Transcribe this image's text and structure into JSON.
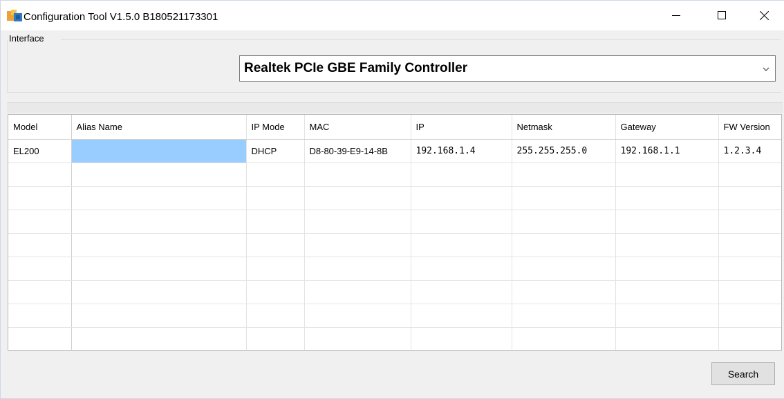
{
  "window": {
    "title": "Configuration Tool V1.5.0 B180521173301",
    "controls": {
      "minimize": "minimize-icon",
      "maximize": "maximize-icon",
      "close": "close-icon"
    }
  },
  "interface": {
    "group_label": "Interface",
    "selected_adapter": "Realtek PCIe GBE Family Controller"
  },
  "table": {
    "columns": [
      "Model",
      "Alias Name",
      "IP Mode",
      "MAC",
      "IP",
      "Netmask",
      "Gateway",
      "FW Version"
    ],
    "rows": [
      {
        "model": "EL200",
        "alias": "",
        "ip_mode": "DHCP",
        "mac": "D8-80-39-E9-14-8B",
        "ip": "192.168.1.4",
        "netmask": "255.255.255.0",
        "gateway": "192.168.1.1",
        "fw": "1.2.3.4"
      }
    ],
    "selection_color": "#99ccff"
  },
  "buttons": {
    "search": "Search"
  }
}
